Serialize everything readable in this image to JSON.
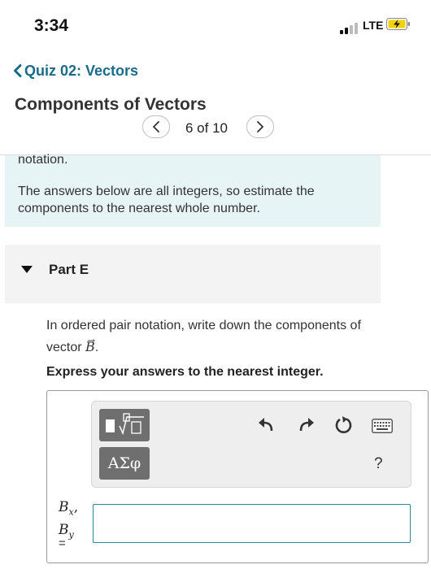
{
  "status_bar": {
    "time": "3:34",
    "network": "LTE"
  },
  "nav": {
    "back_label": "Quiz 02: Vectors",
    "page_title": "Components of Vectors"
  },
  "pager": {
    "text": "6 of 10"
  },
  "info": {
    "fragment": "notation.",
    "note": "The answers below are all integers, so estimate the components to the nearest whole number."
  },
  "part": {
    "label": "Part E"
  },
  "question": {
    "prompt": "In ordered pair notation, write down the components of vector",
    "vector_symbol": "B",
    "period": ".",
    "instruction": "Express your answers to the nearest integer."
  },
  "toolbar": {
    "symbols_label": "ΑΣφ",
    "help_label": "?"
  },
  "answer": {
    "label_bx": "B",
    "label_bx_sub": "x",
    "label_by": "B",
    "label_by_sub": "y",
    "equals": "=",
    "value": ""
  },
  "colors": {
    "accent": "#1a6b8a",
    "info_bg": "#e7f4f5",
    "input_border": "#2a8a93",
    "tool_dark": "#6f6f6f"
  },
  "icons": [
    "signal-icon",
    "battery-charging-icon",
    "chevron-left-icon",
    "chevron-right-icon",
    "triangle-down-icon",
    "template-icon",
    "undo-icon",
    "redo-icon",
    "reset-icon",
    "keyboard-icon"
  ]
}
